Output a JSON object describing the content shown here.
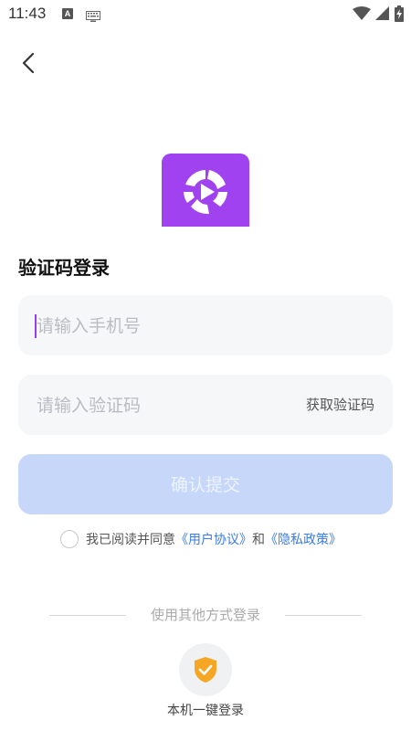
{
  "status_bar": {
    "time": "11:43",
    "left_icons": [
      "a-badge-icon",
      "keyboard-icon"
    ],
    "right_icons": [
      "wifi-icon",
      "signal-icon",
      "battery-charging-icon"
    ]
  },
  "header": {
    "back_icon": "chevron-left-icon"
  },
  "logo": {
    "icon": "app-logo-play-icon",
    "color": "#a142f0"
  },
  "login": {
    "title": "验证码登录",
    "phone_placeholder": "请输入手机号",
    "phone_value": "",
    "code_placeholder": "请输入验证码",
    "code_value": "",
    "get_code_label": "获取验证码",
    "submit_label": "确认提交",
    "submit_color": "#c6d7fa"
  },
  "agreement": {
    "prefix": "我已阅读并同意",
    "user_agreement": "《用户协议》",
    "conjunction": "和",
    "privacy_policy": "《隐私政策》",
    "checked": false,
    "link_color": "#3a7be8"
  },
  "other_login": {
    "divider_text": "使用其他方式登录",
    "onekey_icon": "shield-check-icon",
    "onekey_label": "本机一键登录",
    "accent_color": "#f5a623"
  }
}
